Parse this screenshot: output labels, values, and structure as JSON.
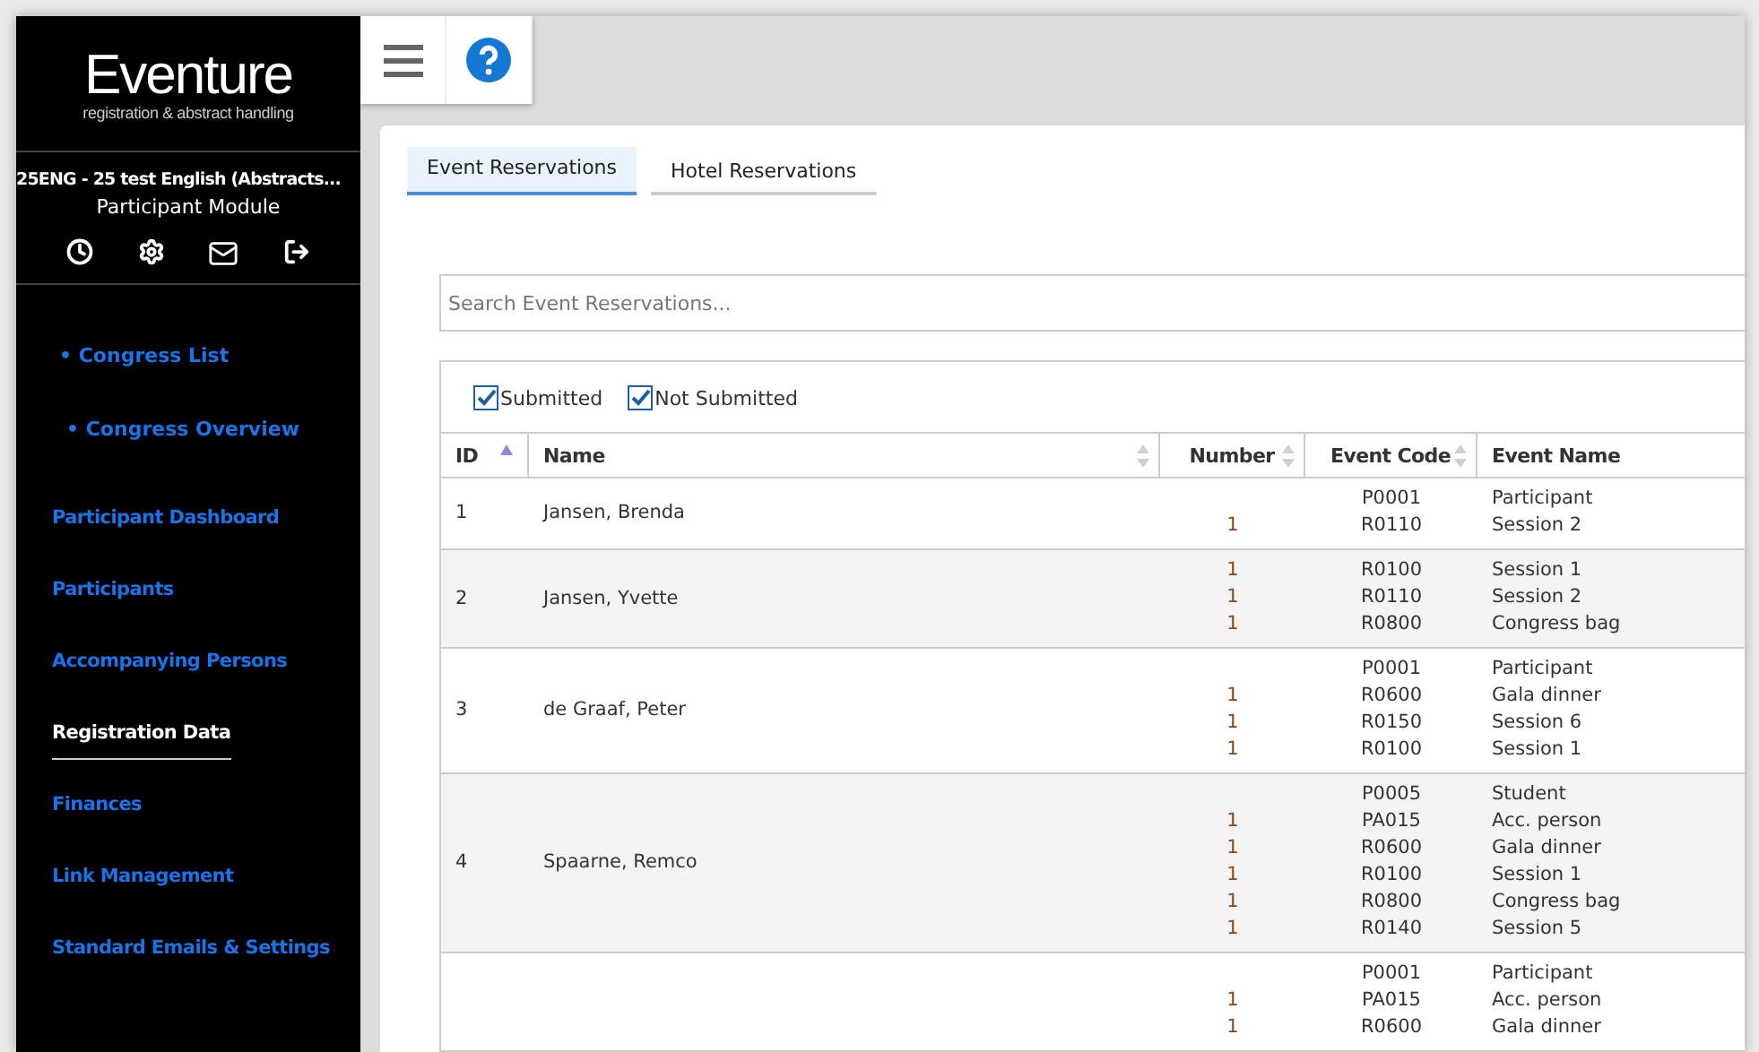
{
  "sidebar": {
    "logo": {
      "name": "Eventure",
      "tagline": "registration & abstract handling"
    },
    "congress": "25ENG - 25 test English (Abstracts...",
    "module": "Participant Module",
    "top_links": [
      {
        "label": "• Congress List"
      },
      {
        "label": "• Congress Overview"
      }
    ],
    "items": [
      {
        "label": "Participant Dashboard",
        "selected": false
      },
      {
        "label": "Participants",
        "selected": false
      },
      {
        "label": "Accompanying Persons",
        "selected": false
      },
      {
        "label": "Registration Data",
        "selected": true
      },
      {
        "label": "Finances",
        "selected": false
      },
      {
        "label": "Link Management",
        "selected": false
      },
      {
        "label": "Standard Emails & Settings",
        "selected": false
      }
    ]
  },
  "tabs": [
    {
      "label": "Event Reservations",
      "selected": true
    },
    {
      "label": "Hotel Reservations",
      "selected": false
    }
  ],
  "search": {
    "placeholder": "Search Event Reservations..."
  },
  "filters": [
    {
      "label": "Submitted",
      "checked": true
    },
    {
      "label": "Not Submitted",
      "checked": true
    }
  ],
  "table": {
    "columns": [
      {
        "label": "ID",
        "sortable": true,
        "sorted": true
      },
      {
        "label": "Name",
        "sortable": true,
        "sorted": false
      },
      {
        "label": "Number",
        "sortable": true,
        "sorted": false
      },
      {
        "label": "Event Code",
        "sortable": true,
        "sorted": false
      },
      {
        "label": "Event Name",
        "sortable": false
      }
    ],
    "rows": [
      {
        "id": "1",
        "name": "Jansen, Brenda",
        "items": [
          {
            "code": "P0001",
            "event": "Participant"
          },
          {
            "number": "1",
            "code": "R0110",
            "event": "Session 2"
          }
        ]
      },
      {
        "id": "2",
        "name": "Jansen, Yvette",
        "items": [
          {
            "number": "1",
            "code": "R0100",
            "event": "Session 1"
          },
          {
            "number": "1",
            "code": "R0110",
            "event": "Session 2"
          },
          {
            "number": "1",
            "code": "R0800",
            "event": "Congress bag"
          }
        ]
      },
      {
        "id": "3",
        "name": "de Graaf, Peter",
        "items": [
          {
            "code": "P0001",
            "event": "Participant"
          },
          {
            "number": "1",
            "code": "R0600",
            "event": "Gala dinner"
          },
          {
            "number": "1",
            "code": "R0150",
            "event": "Session 6"
          },
          {
            "number": "1",
            "code": "R0100",
            "event": "Session 1"
          }
        ]
      },
      {
        "id": "4",
        "name": "Spaarne, Remco",
        "items": [
          {
            "code": "P0005",
            "event": "Student"
          },
          {
            "number": "1",
            "code": "PA015",
            "event": "Acc. person"
          },
          {
            "number": "1",
            "code": "R0600",
            "event": "Gala dinner"
          },
          {
            "number": "1",
            "code": "R0100",
            "event": "Session 1"
          },
          {
            "number": "1",
            "code": "R0800",
            "event": "Congress bag"
          },
          {
            "number": "1",
            "code": "R0140",
            "event": "Session 5"
          }
        ]
      },
      {
        "items": [
          {
            "code": "P0001",
            "event": "Participant"
          },
          {
            "number": "1",
            "code": "PA015",
            "event": "Acc. person"
          },
          {
            "number": "1",
            "code": "R0600",
            "event": "Gala dinner"
          }
        ]
      }
    ]
  }
}
